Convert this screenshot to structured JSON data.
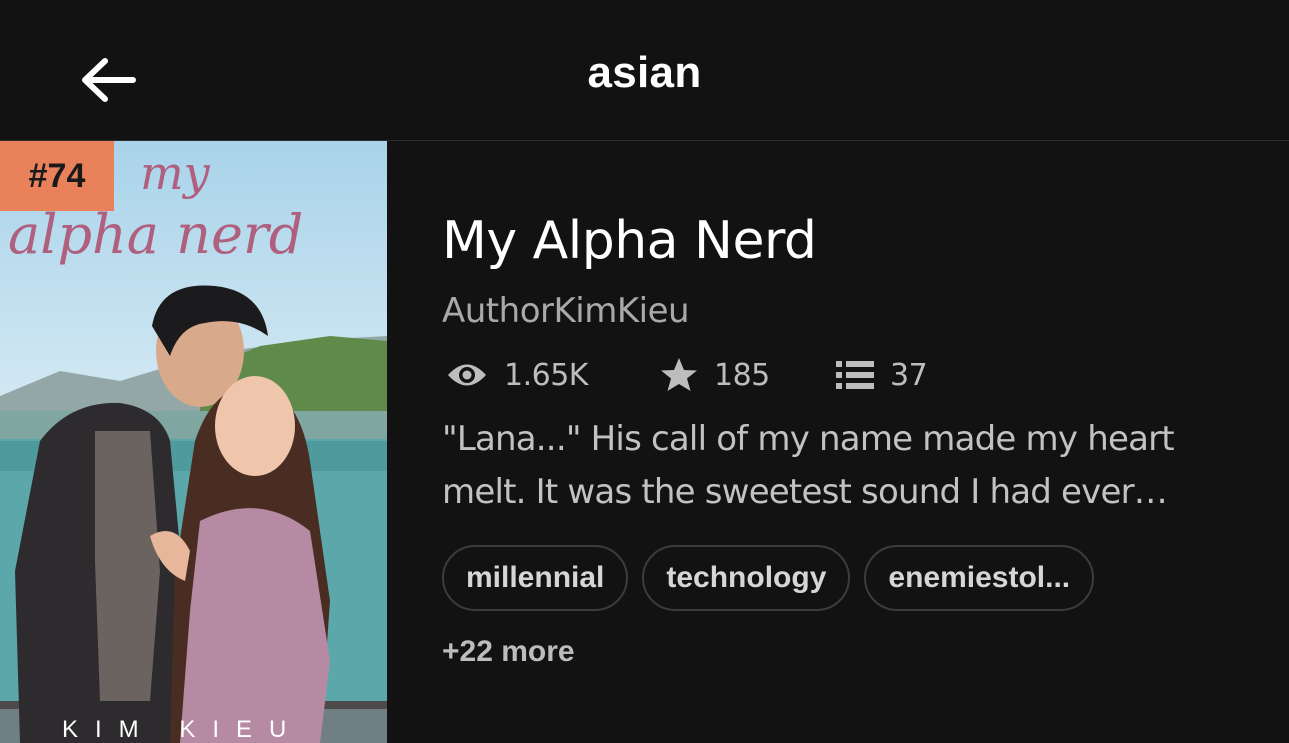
{
  "header": {
    "title": "asian",
    "back_icon": "arrow-left-icon"
  },
  "book": {
    "rank": "#74",
    "cover": {
      "title_line1": "my",
      "title_line2": "alpha nerd",
      "author_line": "KIM KIEU"
    },
    "title": "My Alpha Nerd",
    "author": "AuthorKimKieu",
    "stats": {
      "reads": {
        "icon": "eye-icon",
        "value": "1.65K"
      },
      "votes": {
        "icon": "star-icon",
        "value": "185"
      },
      "parts": {
        "icon": "list-icon",
        "value": "37"
      }
    },
    "description": "\"Lana...\" His call of my name made my heart melt. It was the sweetest sound I had ever heard.",
    "tags": [
      "millennial",
      "technology",
      "enemiestol..."
    ],
    "more_tags": "+22 more"
  },
  "colors": {
    "background": "#121212",
    "rank_badge": "#e9825b",
    "cover_title": "#b0607f"
  }
}
